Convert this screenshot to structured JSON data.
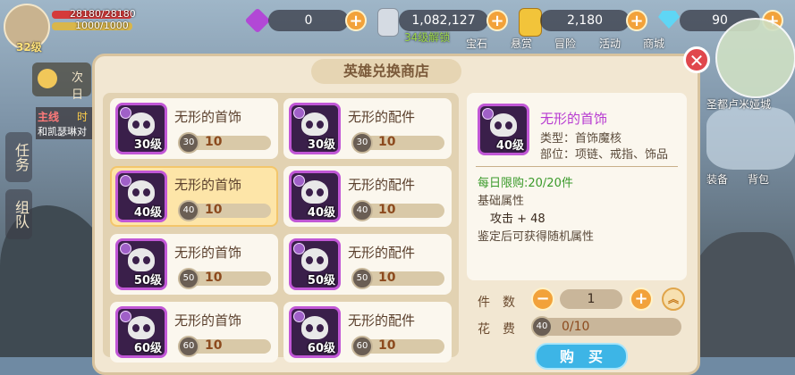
{
  "player": {
    "level": "32级",
    "hp": "28180/28180",
    "mp": "1000/1000"
  },
  "quest": {
    "next_label": "次日",
    "line_label": "主线",
    "line_time": "时",
    "line_desc": "和凯瑟琳对"
  },
  "side_tabs": [
    "任务",
    "组队"
  ],
  "currency": [
    {
      "icon": "purple-gem-icon",
      "value": "0"
    },
    {
      "icon": "silver-coin-stack-icon",
      "value": "1,082,127",
      "note": "34级解锁"
    },
    {
      "icon": "gold-coin-stack-icon",
      "value": "2,180"
    },
    {
      "icon": "diamond-icon",
      "value": "90"
    }
  ],
  "top_nav": [
    "宝石",
    "悬赏",
    "冒险",
    "活动",
    "商城"
  ],
  "map": {
    "location": "圣都卢米娅城"
  },
  "right_icons": [
    "装备",
    "背包"
  ],
  "shop": {
    "title": "英雄兑换商店",
    "items": [
      {
        "name": "无形的首饰",
        "level": "30级",
        "price_level": "30",
        "price": "10",
        "selected": false
      },
      {
        "name": "无形的配件",
        "level": "30级",
        "price_level": "30",
        "price": "10",
        "selected": false
      },
      {
        "name": "无形的首饰",
        "level": "40级",
        "price_level": "40",
        "price": "10",
        "selected": true
      },
      {
        "name": "无形的配件",
        "level": "40级",
        "price_level": "40",
        "price": "10",
        "selected": false
      },
      {
        "name": "无形的首饰",
        "level": "50级",
        "price_level": "50",
        "price": "10",
        "selected": false
      },
      {
        "name": "无形的配件",
        "level": "50级",
        "price_level": "50",
        "price": "10",
        "selected": false
      },
      {
        "name": "无形的首饰",
        "level": "60级",
        "price_level": "60",
        "price": "10",
        "selected": false
      },
      {
        "name": "无形的配件",
        "level": "60级",
        "price_level": "60",
        "price": "10",
        "selected": false
      }
    ],
    "detail": {
      "name": "无形的首饰",
      "level": "40级",
      "type": "类型：首饰魔核",
      "slot": "部位：项链、戒指、饰品",
      "daily_limit": "每日限购:20/20件",
      "base_attr_title": "基础属性",
      "attack": "攻击 + 48",
      "random_note": "鉴定后可获得随机属性"
    },
    "quantity_label": "件　数",
    "quantity": "1",
    "cost_label": "花　费",
    "cost_coin_level": "40",
    "cost": "0/10",
    "buy_label": "购　买"
  },
  "colors": {
    "accent": "#f2a23a",
    "item_border": "#c157d6",
    "buy": "#3db5e6",
    "close": "#e0474c"
  }
}
